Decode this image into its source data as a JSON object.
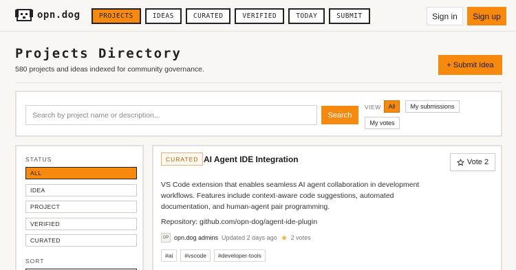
{
  "brand": {
    "name": "opn.dog"
  },
  "nav": [
    {
      "label": "PROJECTS",
      "active": true
    },
    {
      "label": "IDEAS",
      "active": false
    },
    {
      "label": "CURATED",
      "active": false
    },
    {
      "label": "VERIFIED",
      "active": false
    },
    {
      "label": "TODAY",
      "active": false
    },
    {
      "label": "SUBMIT",
      "active": false
    }
  ],
  "auth": {
    "signin": "Sign in",
    "signup": "Sign up"
  },
  "header": {
    "title": "Projects Directory",
    "subtitle": "580 projects and ideas indexed for community governance.",
    "submit_label": "+ Submit Idea"
  },
  "search": {
    "placeholder": "Search by project name or description...",
    "button": "Search",
    "view_label": "VIEW",
    "view_options": [
      "All",
      "My submissions",
      "My votes"
    ],
    "view_selected": "All"
  },
  "sidebar": {
    "status_label": "STATUS",
    "status_items": [
      "ALL",
      "IDEA",
      "PROJECT",
      "VERIFIED",
      "CURATED"
    ],
    "status_selected": "ALL",
    "sort_label": "SORT"
  },
  "card": {
    "badge": "CURATED",
    "title": "AI Agent IDE Integration",
    "vote_label": "Vote 2",
    "description": "VS Code extension that enables seamless AI agent collaboration in development workflows. Features include context-aware code suggestions, automated documentation, and human-agent pair programming.",
    "repository": "Repository: github.com/opn-dog/agent-ide-plugin",
    "avatar_initials": "OP",
    "author": "opn.dog admins",
    "updated": "Updated 2 days ago",
    "votes": "2 votes",
    "tags": [
      "#ai",
      "#vscode",
      "#developer-tools"
    ]
  },
  "colors": {
    "accent": "#f7890f",
    "background": "#f8f7f4"
  }
}
